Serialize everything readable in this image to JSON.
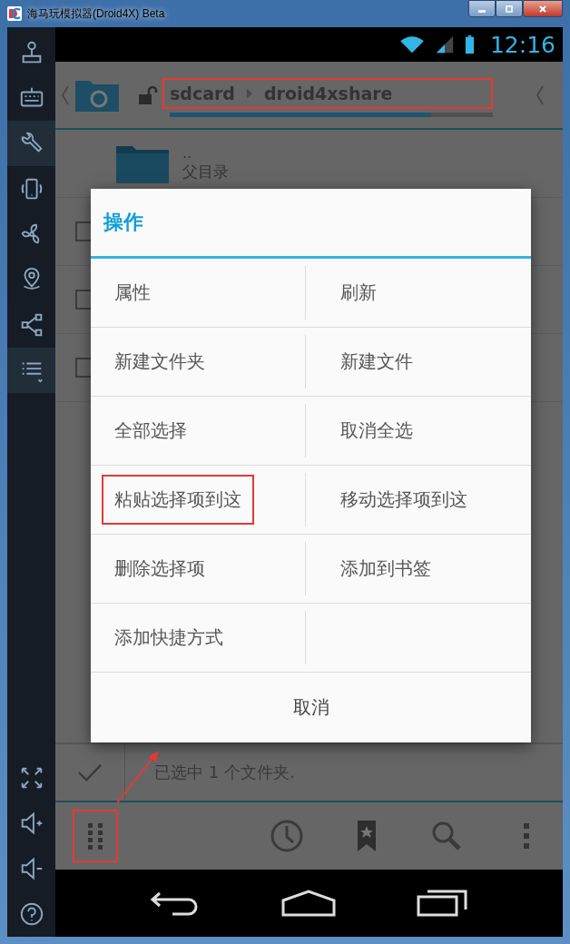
{
  "window": {
    "title": "海马玩模拟器(Droid4X) Beta"
  },
  "sidebar": {
    "top": [
      {
        "kind": "joystick",
        "selected": false
      },
      {
        "kind": "keyboard",
        "selected": false
      },
      {
        "kind": "wrench",
        "selected": true
      },
      {
        "kind": "phone",
        "selected": false
      },
      {
        "kind": "fan",
        "selected": false
      },
      {
        "kind": "location",
        "selected": false
      },
      {
        "kind": "share",
        "selected": false
      },
      {
        "kind": "list",
        "selected": true
      }
    ],
    "bottom": [
      {
        "kind": "fullscreen"
      },
      {
        "kind": "volume_up"
      },
      {
        "kind": "volume_down"
      },
      {
        "kind": "help"
      }
    ]
  },
  "status_bar": {
    "time": "12:16"
  },
  "path": {
    "segments": [
      {
        "label": "sdcard"
      },
      {
        "label": "droid4xshare"
      }
    ],
    "highlighted": true,
    "level": 0.81
  },
  "files": [
    {
      "kind": "parent",
      "name": "..",
      "subtitle": "父目录"
    },
    {
      "kind": "item",
      "checked": false
    },
    {
      "kind": "item",
      "checked": false
    },
    {
      "kind": "item",
      "checked": false
    }
  ],
  "dialog": {
    "title": "操作",
    "options": [
      {
        "label": "属性",
        "highlighted": false
      },
      {
        "label": "刷新",
        "highlighted": false
      },
      {
        "label": "新建文件夹",
        "highlighted": false
      },
      {
        "label": "新建文件",
        "highlighted": false
      },
      {
        "label": "全部选择",
        "highlighted": false
      },
      {
        "label": "取消全选",
        "highlighted": false
      },
      {
        "label": "粘贴选择项到这",
        "highlighted": true
      },
      {
        "label": "移动选择项到这",
        "highlighted": false
      },
      {
        "label": "删除选择项",
        "highlighted": false
      },
      {
        "label": "添加到书签",
        "highlighted": false
      },
      {
        "label": "添加快捷方式",
        "highlighted": false
      }
    ],
    "cancel": "取消"
  },
  "selection_bar": {
    "text": "已选中 1 个文件夹."
  },
  "toolbar": [
    {
      "kind": "grid",
      "highlighted": true
    },
    {
      "kind": "clock",
      "highlighted": false
    },
    {
      "kind": "bookmark",
      "highlighted": false
    },
    {
      "kind": "search",
      "highlighted": false
    },
    {
      "kind": "overflow",
      "highlighted": false
    }
  ]
}
